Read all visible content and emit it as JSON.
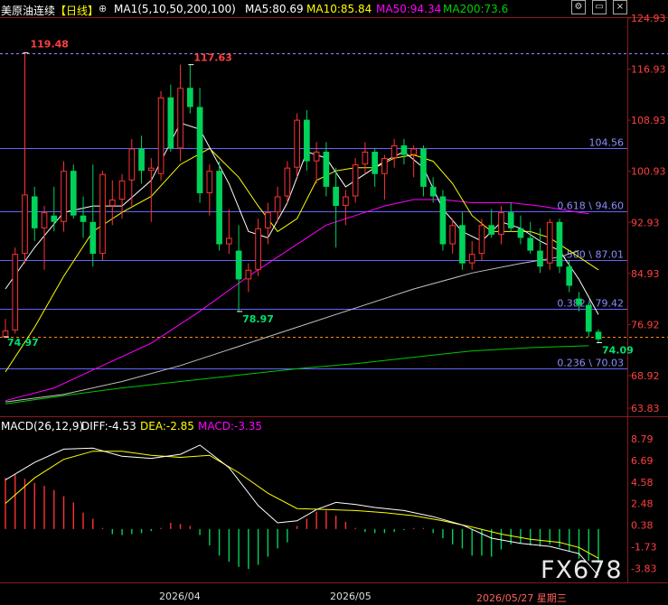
{
  "header": {
    "symbol": "美原油连续",
    "period": "【日线】",
    "ma_params": "MA1(5,10,50,200,100)",
    "ma5": "MA5:80.69",
    "ma10": "MA10:85.84",
    "ma50": "MA50:94.34",
    "ma200": "MA200:73.6"
  },
  "macd_header": {
    "params": "MACD(26,12,9)",
    "diff": "DIFF:-4.53",
    "dea": "DEA:-2.85",
    "macd": "MACD:-3.35"
  },
  "colors": {
    "background": "#000000",
    "up": "#ff3232",
    "down": "#00d25a",
    "ma5": "#ffffff",
    "ma10": "#ffff00",
    "ma50": "#ff00ff",
    "ma200": "#00c800",
    "ma100": "#c0c0c0",
    "fib_line": "#6464ff",
    "fib_text": "#8c8cff",
    "axis_text": "#ff4040",
    "low_text": "#00e070"
  },
  "icons": [
    "settings-icon",
    "window-icon",
    "close-icon"
  ],
  "watermark": "FX678",
  "date_labels": [
    "2026/04",
    "2026/05",
    "2026/05/27 星期三"
  ],
  "price_axis": {
    "labels": [
      "124.93",
      "116.93",
      "108.93",
      "100.93",
      "92.93",
      "84.93",
      "76.92",
      "68.92",
      "63.83"
    ]
  },
  "macd_axis": {
    "labels": [
      "8.79",
      "6.69",
      "4.58",
      "2.48",
      "0.38",
      "-1.73",
      "-3.83"
    ]
  },
  "chart_data": {
    "type": "candlestick",
    "ylim": [
      63.83,
      124.93
    ],
    "candles": [
      [
        75.0,
        77.8,
        74.97,
        76.0
      ],
      [
        76.0,
        89.0,
        75.5,
        88.0
      ],
      [
        88.0,
        119.48,
        86.5,
        97.3
      ],
      [
        97.0,
        98.5,
        90.0,
        92.0
      ],
      [
        92.0,
        95.5,
        85.5,
        94.5
      ],
      [
        94.0,
        98.5,
        91.5,
        93.0
      ],
      [
        93.0,
        102.5,
        91.5,
        101.0
      ],
      [
        101.0,
        102.0,
        93.5,
        94.0
      ],
      [
        94.0,
        97.0,
        90.5,
        93.0
      ],
      [
        93.0,
        102.0,
        86.0,
        88.0
      ],
      [
        88.0,
        101.0,
        87.0,
        100.5
      ],
      [
        95.5,
        99.5,
        92.5,
        96.5
      ],
      [
        96.5,
        100.5,
        93.5,
        99.5
      ],
      [
        99.5,
        106.0,
        95.5,
        104.5
      ],
      [
        104.5,
        106.5,
        99.0,
        101.0
      ],
      [
        101.0,
        103.0,
        93.0,
        101.5
      ],
      [
        100.5,
        113.5,
        99.5,
        112.5
      ],
      [
        112.5,
        114.5,
        104.0,
        104.5
      ],
      [
        104.5,
        117.63,
        102.5,
        114.0
      ],
      [
        114.0,
        117.63,
        110.0,
        111.0
      ],
      [
        111.0,
        114.0,
        96.0,
        97.5
      ],
      [
        97.5,
        102.0,
        94.0,
        101.0
      ],
      [
        101.0,
        102.5,
        88.5,
        89.5
      ],
      [
        89.5,
        95.0,
        88.0,
        90.5
      ],
      [
        88.5,
        92.5,
        78.97,
        84.0
      ],
      [
        84.0,
        86.5,
        82.0,
        85.5
      ],
      [
        85.5,
        93.5,
        84.5,
        92.0
      ],
      [
        92.0,
        96.0,
        89.5,
        94.5
      ],
      [
        94.5,
        98.5,
        93.0,
        97.0
      ],
      [
        97.0,
        102.5,
        96.0,
        101.5
      ],
      [
        101.5,
        110.0,
        100.0,
        109.0
      ],
      [
        109.0,
        110.5,
        101.0,
        102.5
      ],
      [
        102.5,
        105.5,
        99.0,
        104.0
      ],
      [
        104.0,
        105.5,
        97.0,
        98.5
      ],
      [
        98.5,
        101.5,
        89.0,
        95.5
      ],
      [
        95.5,
        98.0,
        92.5,
        97.0
      ],
      [
        97.0,
        103.0,
        96.0,
        102.0
      ],
      [
        102.0,
        105.5,
        100.5,
        104.0
      ],
      [
        104.0,
        104.5,
        98.5,
        100.5
      ],
      [
        100.5,
        103.5,
        96.5,
        103.0
      ],
      [
        103.0,
        106.0,
        101.5,
        105.0
      ],
      [
        105.0,
        106.0,
        102.0,
        103.5
      ],
      [
        103.5,
        105.0,
        100.0,
        104.5
      ],
      [
        104.5,
        105.0,
        97.0,
        98.5
      ],
      [
        98.5,
        100.0,
        96.0,
        97.0
      ],
      [
        97.0,
        98.0,
        88.5,
        89.5
      ],
      [
        89.5,
        93.5,
        88.0,
        92.5
      ],
      [
        92.5,
        94.5,
        85.5,
        86.5
      ],
      [
        86.5,
        90.0,
        85.5,
        88.0
      ],
      [
        88.0,
        93.5,
        87.0,
        92.5
      ],
      [
        92.5,
        95.0,
        90.5,
        91.0
      ],
      [
        91.0,
        95.5,
        89.5,
        94.5
      ],
      [
        94.5,
        96.0,
        91.5,
        92.0
      ],
      [
        92.0,
        94.0,
        89.5,
        90.5
      ],
      [
        90.5,
        93.0,
        88.0,
        88.5
      ],
      [
        88.5,
        92.0,
        85.0,
        86.0
      ],
      [
        86.5,
        93.5,
        85.5,
        93.0
      ],
      [
        93.0,
        93.5,
        85.0,
        86.0
      ],
      [
        86.0,
        87.0,
        82.0,
        83.0
      ],
      [
        81.0,
        82.0,
        79.0,
        80.0
      ],
      [
        80.0,
        80.5,
        75.0,
        75.8
      ],
      [
        75.8,
        76.2,
        74.09,
        74.6
      ]
    ],
    "ma5": [
      [
        0,
        82.5
      ],
      [
        3,
        89.0
      ],
      [
        6,
        94.5
      ],
      [
        9,
        95.5
      ],
      [
        12,
        95.5
      ],
      [
        15,
        99.5
      ],
      [
        18,
        108.5
      ],
      [
        20,
        107.5
      ],
      [
        23,
        99.0
      ],
      [
        25,
        91.5
      ],
      [
        27,
        90.5
      ],
      [
        29,
        96.0
      ],
      [
        31,
        104.0
      ],
      [
        33,
        103.0
      ],
      [
        35,
        98.5
      ],
      [
        37,
        100.5
      ],
      [
        39,
        102.5
      ],
      [
        41,
        104.0
      ],
      [
        43,
        101.5
      ],
      [
        45,
        95.0
      ],
      [
        47,
        91.5
      ],
      [
        49,
        90.0
      ],
      [
        51,
        93.0
      ],
      [
        53,
        92.0
      ],
      [
        55,
        90.0
      ],
      [
        57,
        88.5
      ],
      [
        59,
        84.0
      ],
      [
        61,
        78.5
      ]
    ],
    "ma10": [
      [
        0,
        69.5
      ],
      [
        3,
        76.5
      ],
      [
        6,
        84.5
      ],
      [
        9,
        91.5
      ],
      [
        12,
        94.5
      ],
      [
        15,
        97.0
      ],
      [
        18,
        102.0
      ],
      [
        21,
        104.5
      ],
      [
        24,
        100.0
      ],
      [
        26,
        95.5
      ],
      [
        28,
        91.5
      ],
      [
        30,
        93.5
      ],
      [
        32,
        99.5
      ],
      [
        34,
        101.0
      ],
      [
        36,
        101.5
      ],
      [
        38,
        101.5
      ],
      [
        40,
        103.0
      ],
      [
        42,
        103.5
      ],
      [
        44,
        102.5
      ],
      [
        46,
        99.0
      ],
      [
        48,
        94.0
      ],
      [
        50,
        91.5
      ],
      [
        52,
        91.5
      ],
      [
        54,
        91.5
      ],
      [
        56,
        90.5
      ],
      [
        58,
        88.5
      ],
      [
        60,
        86.5
      ],
      [
        61,
        85.5
      ]
    ],
    "ma50": [
      [
        0,
        65.0
      ],
      [
        5,
        67.0
      ],
      [
        10,
        70.5
      ],
      [
        15,
        74.0
      ],
      [
        20,
        79.0
      ],
      [
        25,
        84.5
      ],
      [
        29,
        88.5
      ],
      [
        33,
        92.5
      ],
      [
        36,
        94.0
      ],
      [
        39,
        95.5
      ],
      [
        42,
        96.5
      ],
      [
        45,
        96.5
      ],
      [
        48,
        96.0
      ],
      [
        52,
        96.0
      ],
      [
        55,
        95.5
      ],
      [
        57,
        95.0
      ],
      [
        59,
        94.5
      ],
      [
        60,
        94.3
      ]
    ],
    "ma100": [
      [
        0,
        64.8
      ],
      [
        6,
        66.0
      ],
      [
        12,
        68.0
      ],
      [
        18,
        70.5
      ],
      [
        24,
        73.5
      ],
      [
        30,
        76.5
      ],
      [
        36,
        79.5
      ],
      [
        42,
        82.5
      ],
      [
        48,
        85.0
      ],
      [
        53,
        86.5
      ],
      [
        57,
        87.5
      ],
      [
        59,
        88.5
      ]
    ],
    "ma200": [
      [
        0,
        64.5
      ],
      [
        6,
        65.8
      ],
      [
        12,
        67.0
      ],
      [
        18,
        68.0
      ],
      [
        24,
        69.0
      ],
      [
        30,
        70.0
      ],
      [
        36,
        70.8
      ],
      [
        42,
        71.8
      ],
      [
        48,
        72.8
      ],
      [
        54,
        73.3
      ],
      [
        60,
        73.6
      ]
    ],
    "fib_levels": [
      {
        "price": 104.56,
        "label": "104.56"
      },
      {
        "price": 94.6,
        "label": "0.618 \\ 94.60"
      },
      {
        "price": 87.01,
        "label": "0.500 \\ 87.01"
      },
      {
        "price": 79.42,
        "label": "0.382 \\ 79.42"
      },
      {
        "price": 70.03,
        "label": "0.236 \\ 70.03"
      }
    ],
    "ref_lines": [
      {
        "price": 119.48,
        "style": "dashed",
        "color": "#9090ff"
      },
      {
        "price": 74.97,
        "style": "dashed",
        "color": "#ff8c00"
      }
    ],
    "annotations": [
      {
        "text": "119.48",
        "price": 119.48,
        "candle": 2
      },
      {
        "text": "117.63",
        "price": 117.63,
        "candle": 19
      },
      {
        "text": "78.97",
        "price": 78.97,
        "candle": 24
      },
      {
        "text": "74.97",
        "price": 74.97,
        "candle": 0
      },
      {
        "text": "74.09",
        "price": 74.09,
        "candle": 61
      }
    ],
    "macd": {
      "ylim": [
        -4.6,
        9.6
      ],
      "hist": [
        5.0,
        5.3,
        4.9,
        4.5,
        4.2,
        3.8,
        3.2,
        2.6,
        1.6,
        1.0,
        0.1,
        -0.5,
        -0.6,
        -0.5,
        -0.4,
        -0.2,
        0.1,
        0.6,
        0.5,
        0.3,
        -0.6,
        -1.6,
        -2.6,
        -3.2,
        -3.7,
        -3.9,
        -3.5,
        -2.7,
        -1.9,
        -1.3,
        0.3,
        1.0,
        1.7,
        1.8,
        1.3,
        0.7,
        0.1,
        -0.3,
        -0.4,
        -0.4,
        -0.3,
        -0.1,
        0.1,
        0.1,
        -0.4,
        -0.9,
        -1.5,
        -1.9,
        -2.6,
        -2.6,
        -2.7,
        -2.0,
        -1.5,
        -1.4,
        -1.6,
        -1.7,
        -1.5,
        -1.8,
        -2.2,
        -2.9,
        -3.1,
        -3.35
      ],
      "diff": [
        [
          0,
          4.8
        ],
        [
          3,
          6.5
        ],
        [
          6,
          7.8
        ],
        [
          9,
          7.9
        ],
        [
          12,
          7.1
        ],
        [
          15,
          6.9
        ],
        [
          18,
          7.3
        ],
        [
          20,
          8.2
        ],
        [
          23,
          6.0
        ],
        [
          26,
          2.3
        ],
        [
          28,
          0.6
        ],
        [
          30,
          0.8
        ],
        [
          32,
          1.9
        ],
        [
          34,
          2.6
        ],
        [
          36,
          2.4
        ],
        [
          38,
          2.1
        ],
        [
          41,
          1.8
        ],
        [
          44,
          1.2
        ],
        [
          47,
          0.4
        ],
        [
          50,
          -0.9
        ],
        [
          53,
          -1.4
        ],
        [
          56,
          -1.7
        ],
        [
          59,
          -2.4
        ],
        [
          61,
          -4.53
        ]
      ],
      "dea": [
        [
          0,
          2.5
        ],
        [
          3,
          5.0
        ],
        [
          6,
          6.8
        ],
        [
          9,
          7.6
        ],
        [
          12,
          7.6
        ],
        [
          15,
          7.2
        ],
        [
          18,
          7.0
        ],
        [
          21,
          7.2
        ],
        [
          24,
          5.5
        ],
        [
          27,
          3.5
        ],
        [
          30,
          2.0
        ],
        [
          33,
          1.9
        ],
        [
          36,
          1.8
        ],
        [
          39,
          1.6
        ],
        [
          42,
          1.3
        ],
        [
          45,
          0.8
        ],
        [
          48,
          0.2
        ],
        [
          51,
          -0.5
        ],
        [
          54,
          -1.0
        ],
        [
          57,
          -1.3
        ],
        [
          59,
          -1.8
        ],
        [
          61,
          -2.85
        ]
      ]
    }
  }
}
